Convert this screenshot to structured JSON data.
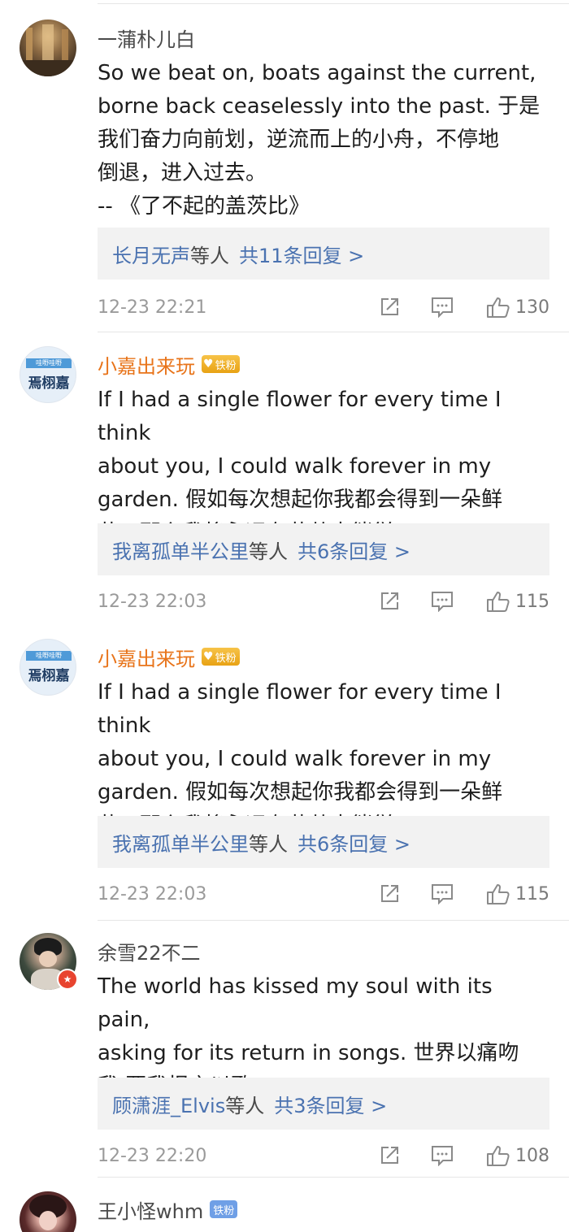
{
  "comments": [
    {
      "username": "一蒲朴儿白",
      "text": "So we beat on, boats against the current,\nborne back ceaselessly into the past. 于是\n我们奋力向前划，逆流而上的小舟，不停地\n倒退，进入过去。\n-- 《了不起的盖茨比》",
      "reply_users": "长月无声",
      "reply_suffix": "等人",
      "reply_count": "共11条回复 >",
      "time": "12-23 22:21",
      "likes": "130"
    },
    {
      "username": "小嘉出来玩",
      "badge": "铁粉",
      "avatar_text_top": "哇嘢哇嘢",
      "avatar_text_main": "焉栩嘉",
      "text": "If I had a single flower for every time I think\nabout you, I could walk forever in my\ngarden. 假如每次想起你我都会得到一朵鲜\n花，那么我将永远在花丛中徜徉。",
      "reply_users": "我离孤单半公里",
      "reply_suffix": "等人",
      "reply_count": "共6条回复 >",
      "time": "12-23 22:03",
      "likes": "115"
    },
    {
      "username": "小嘉出来玩",
      "badge": "铁粉",
      "avatar_text_top": "哇嘢哇嘢",
      "avatar_text_main": "焉栩嘉",
      "text": "If I had a single flower for every time I think\nabout you, I could walk forever in my\ngarden. 假如每次想起你我都会得到一朵鲜\n花，那么我将永远在花丛中徜徉。",
      "reply_users": "我离孤单半公里",
      "reply_suffix": "等人",
      "reply_count": "共6条回复 >",
      "time": "12-23 22:03",
      "likes": "115"
    },
    {
      "username": "余雪22不二",
      "text": "The world has kissed my soul with its pain,\nasking for its return in songs. 世界以痛吻\n我 要我报之以歌",
      "reply_users": "顾潇涯_Elvis",
      "reply_suffix": "等人",
      "reply_count": "共3条回复 >",
      "time": "12-23 22:20",
      "likes": "108"
    },
    {
      "username": "王小怪whm",
      "badge": "铁粉"
    }
  ],
  "colors": {
    "link_blue": "#4a72b0",
    "vip_orange": "#e8741a",
    "reply_bg": "#f2f2f2",
    "time_gray": "#9a9a9a"
  }
}
